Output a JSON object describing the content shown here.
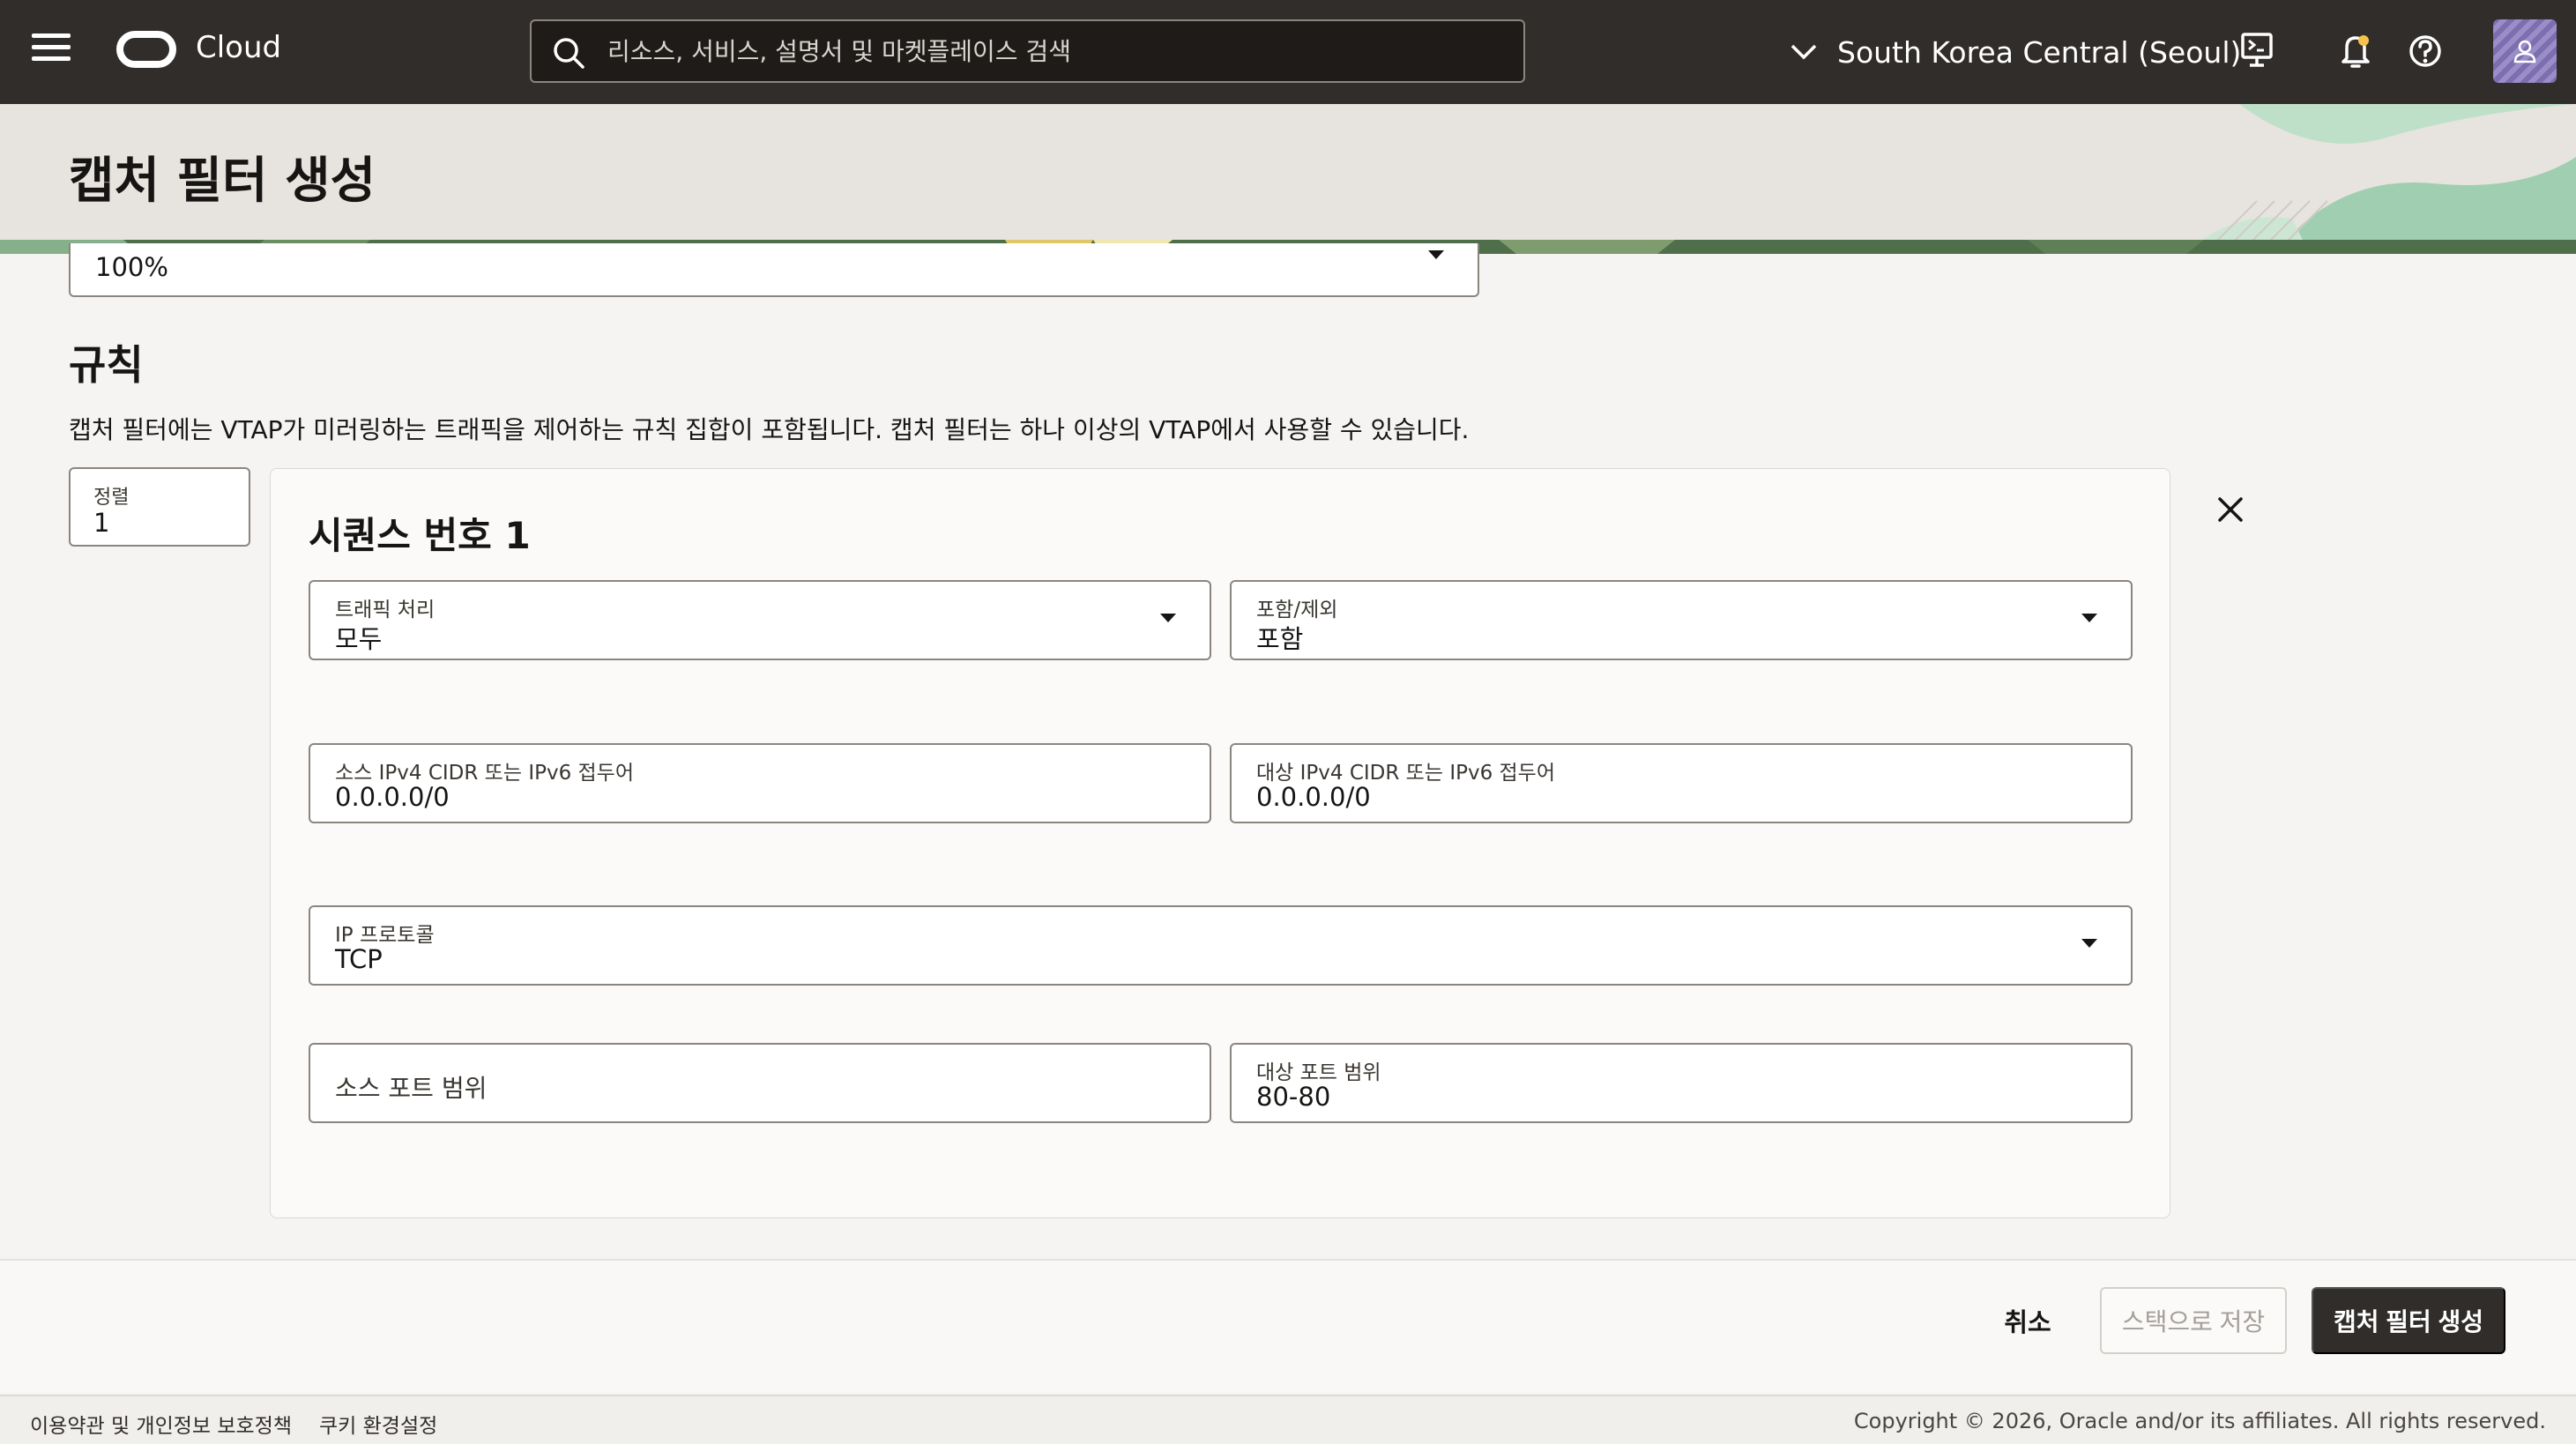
{
  "topbar": {
    "brand": "Cloud",
    "search_placeholder": "리소스, 서비스, 설명서 및 마켓플레이스 검색",
    "region": "South Korea Central (Seoul)"
  },
  "page": {
    "title": "캡처 필터 생성"
  },
  "sampling": {
    "value": "100%"
  },
  "rules": {
    "title": "규칙",
    "description": "캡처 필터에는 VTAP가 미러링하는 트래픽을 제어하는 규칙 집합이 포함됩니다. 캡처 필터는 하나 이상의 VTAP에서 사용할 수 있습니다.",
    "order": {
      "label": "정렬",
      "value": "1"
    },
    "sequence_title": "시퀀스 번호 1",
    "traffic_direction": {
      "label": "트래픽 처리",
      "value": "모두"
    },
    "include_exclude": {
      "label": "포함/제외",
      "value": "포함"
    },
    "source_cidr": {
      "label": "소스 IPv4 CIDR 또는 IPv6 접두어",
      "value": "0.0.0.0/0"
    },
    "dest_cidr": {
      "label": "대상 IPv4 CIDR 또는 IPv6 접두어",
      "value": "0.0.0.0/0"
    },
    "ip_protocol": {
      "label": "IP 프로토콜",
      "value": "TCP"
    },
    "source_port": {
      "placeholder": "소스 포트 범위"
    },
    "dest_port": {
      "label": "대상 포트 범위",
      "value": "80-80"
    }
  },
  "actions": {
    "cancel": "취소",
    "save_stack": "스택으로 저장",
    "create": "캡처 필터 생성"
  },
  "footer": {
    "terms": "이용약관 및 개인정보 보호정책",
    "cookies": "쿠키 환경설정",
    "copyright": "Copyright © 2026, Oracle and/or its affiliates. All rights reserved."
  },
  "colors": {
    "topbar": "#312d2a",
    "primary_button": "#312d2a",
    "page_bg": "#f5f4f2",
    "header_band": "#e7e4df",
    "accent_green": "#9fcfb0"
  },
  "icons": [
    "menu-icon",
    "oracle-logo",
    "search-icon",
    "chevron-down-icon",
    "cloud-shell-icon",
    "bell-icon",
    "help-icon",
    "user-icon",
    "close-icon",
    "caret-down-icon"
  ]
}
